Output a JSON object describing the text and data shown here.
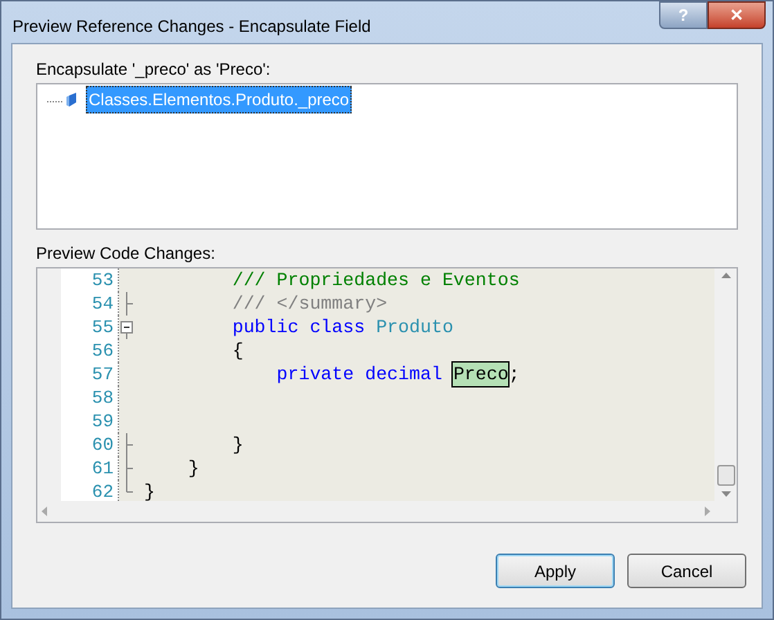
{
  "window": {
    "title": "Preview Reference Changes - Encapsulate Field",
    "help_button": "?",
    "close_button": "✕"
  },
  "references": {
    "label": "Encapsulate '_preco' as 'Preco':",
    "items": [
      {
        "text": "Classes.Elementos.Produto._preco",
        "selected": true
      }
    ]
  },
  "code_preview": {
    "label": "Preview Code Changes:",
    "lines": [
      {
        "number": "53",
        "kind": "plain",
        "tokens": [
          {
            "text": "        /// Propriedades e Eventos",
            "kind": "comment"
          }
        ]
      },
      {
        "number": "54",
        "kind": "fold_line",
        "tokens": [
          {
            "text": "        /// </summary>",
            "kind": "doc"
          }
        ]
      },
      {
        "number": "55",
        "kind": "fold_start",
        "tokens": [
          {
            "text": "        public class",
            "kind": "keyword"
          },
          {
            "text": " Produto",
            "kind": "type"
          }
        ]
      },
      {
        "number": "56",
        "kind": "plain",
        "tokens": [
          {
            "text": "        {",
            "kind": "plain"
          }
        ]
      },
      {
        "number": "57",
        "kind": "plain",
        "tokens": [
          {
            "text": "            private decimal ",
            "kind": "keyword"
          },
          {
            "text": "Preco",
            "kind": "changed"
          },
          {
            "text": ";",
            "kind": "plain"
          }
        ]
      },
      {
        "number": "58",
        "kind": "plain"
      },
      {
        "number": "59",
        "kind": "plain"
      },
      {
        "number": "60",
        "kind": "fold_line",
        "tokens": [
          {
            "text": "        }",
            "kind": "plain"
          }
        ]
      },
      {
        "number": "61",
        "kind": "fold_line",
        "tokens": [
          {
            "text": "    }",
            "kind": "plain"
          }
        ]
      },
      {
        "number": "62",
        "kind": "fold_end",
        "tokens": [
          {
            "text": "}",
            "kind": "plain"
          }
        ]
      }
    ]
  },
  "buttons": [
    {
      "label": "Apply",
      "default": true
    },
    {
      "label": "Cancel",
      "default": false
    }
  ]
}
